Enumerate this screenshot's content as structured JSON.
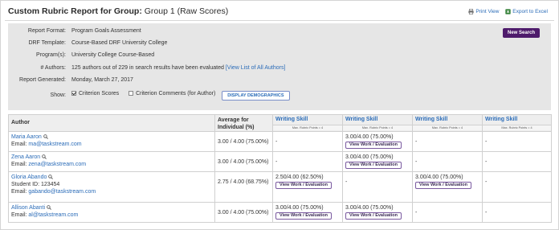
{
  "header": {
    "title_bold": "Custom Rubric Report for Group:",
    "title_rest": " Group 1 (Raw Scores)",
    "print_view": "Print View",
    "export_excel": "Export to Excel"
  },
  "panel": {
    "new_search": "New Search",
    "fields": [
      {
        "label": "Report Format:",
        "value": "Program Goals Assessment"
      },
      {
        "label": "DRF Template:",
        "value": "Course-Based DRF University College"
      },
      {
        "label": "Program(s):",
        "value": "University College Course-Based"
      },
      {
        "label": "# Authors:",
        "value": "125 authors out of 229 in search results have been evaluated ",
        "link": "[View List of All Authors]"
      },
      {
        "label": "Report Generated:",
        "value": "Monday, March 27, 2017"
      }
    ],
    "show_label": "Show:",
    "criterion_scores": "Criterion Scores",
    "criterion_comments": "Criterion Comments (for Author)",
    "demographics_button": "DISPLAY DEMOGRAPHICS"
  },
  "table": {
    "col_author": "Author",
    "col_average": "Average for Individual (%)",
    "skill_label": "Writing Skill",
    "max_points": "Max. Rubric Points = 4",
    "view_work": "View Work / Evaluation",
    "rows": [
      {
        "name": "Maria Aaron",
        "student_id": "",
        "email_label": "Email: ",
        "email": "ma@taskstream.com",
        "average": "3.00 / 4.00 (75.00%)",
        "scores": [
          {
            "value": "-",
            "button": false
          },
          {
            "value": "3.00/4.00 (75.00%)",
            "button": true
          },
          {
            "value": "-",
            "button": false
          },
          {
            "value": "-",
            "button": false
          }
        ]
      },
      {
        "name": "Zena Aaron",
        "student_id": "",
        "email_label": "Email: ",
        "email": "zena@taskstream.com",
        "average": "3.00 / 4.00 (75.00%)",
        "scores": [
          {
            "value": "-",
            "button": false
          },
          {
            "value": "3.00/4.00 (75.00%)",
            "button": true
          },
          {
            "value": "-",
            "button": false
          },
          {
            "value": "-",
            "button": false
          }
        ]
      },
      {
        "name": "Gloria Abando",
        "student_id": "Student ID: 123454",
        "email_label": "Email: ",
        "email": "gabando@taskstream.com",
        "average": "2.75 / 4.00 (68.75%)",
        "scores": [
          {
            "value": "2.50/4.00 (62.50%)",
            "button": true
          },
          {
            "value": "-",
            "button": false
          },
          {
            "value": "3.00/4.00 (75.00%)",
            "button": true
          },
          {
            "value": "-",
            "button": false
          }
        ]
      },
      {
        "name": "Allison Abanti",
        "student_id": "",
        "email_label": "Email: ",
        "email": "al@taskstream.com",
        "average": "3.00 / 4.00 (75.00%)",
        "scores": [
          {
            "value": "3.00/4.00 (75.00%)",
            "button": true
          },
          {
            "value": "3.00/4.00 (75.00%)",
            "button": true
          },
          {
            "value": "-",
            "button": false
          },
          {
            "value": "-",
            "button": false
          }
        ]
      }
    ]
  },
  "colors": {
    "accent_purple": "#4e1b6b",
    "link_blue": "#2b6cb8",
    "panel_gray": "#e6e6e6"
  }
}
